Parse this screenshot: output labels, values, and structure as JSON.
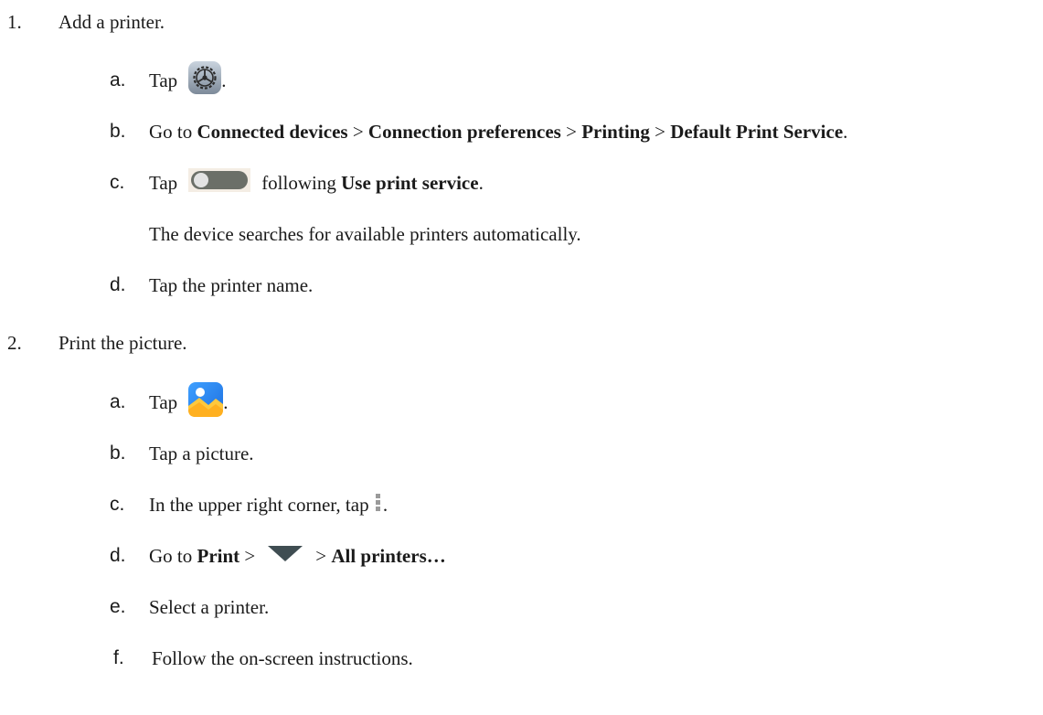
{
  "steps": [
    {
      "number": "1.",
      "title": "Add a printer.",
      "substeps": {
        "a": {
          "letter": "a.",
          "tap": "Tap",
          "end": "."
        },
        "b": {
          "letter": "b.",
          "go_to": "Go to",
          "p1": "Connected devices",
          "sep": ">",
          "p2": "Connection preferences",
          "p3": "Printing",
          "p4": "Default Print Service",
          "end": "."
        },
        "c": {
          "letter": "c.",
          "tap": "Tap",
          "following": "following",
          "bold": "Use print service",
          "end": "."
        },
        "c_note": "The device searches for available printers automatically.",
        "d": {
          "letter": "d.",
          "text": "Tap the printer name."
        }
      }
    },
    {
      "number": "2.",
      "title": "Print the picture.",
      "substeps": {
        "a": {
          "letter": "a.",
          "tap": "Tap",
          "end": "."
        },
        "b": {
          "letter": "b.",
          "text": "Tap a picture."
        },
        "c": {
          "letter": "c.",
          "text": "In the upper right corner, tap",
          "end": "."
        },
        "d": {
          "letter": "d.",
          "go_to": "Go to",
          "p1": "Print",
          "sep": ">",
          "p2": "All printers…"
        },
        "e": {
          "letter": "e.",
          "text": "Select a printer."
        },
        "f": {
          "letter": "f.",
          "text": "Follow the on-screen instructions."
        }
      }
    }
  ],
  "icons": {
    "settings": "settings-gear-icon",
    "toggle": "toggle-switch-icon",
    "gallery": "gallery-icon",
    "more": "more-vertical-icon",
    "dropdown": "dropdown-triangle-icon"
  }
}
